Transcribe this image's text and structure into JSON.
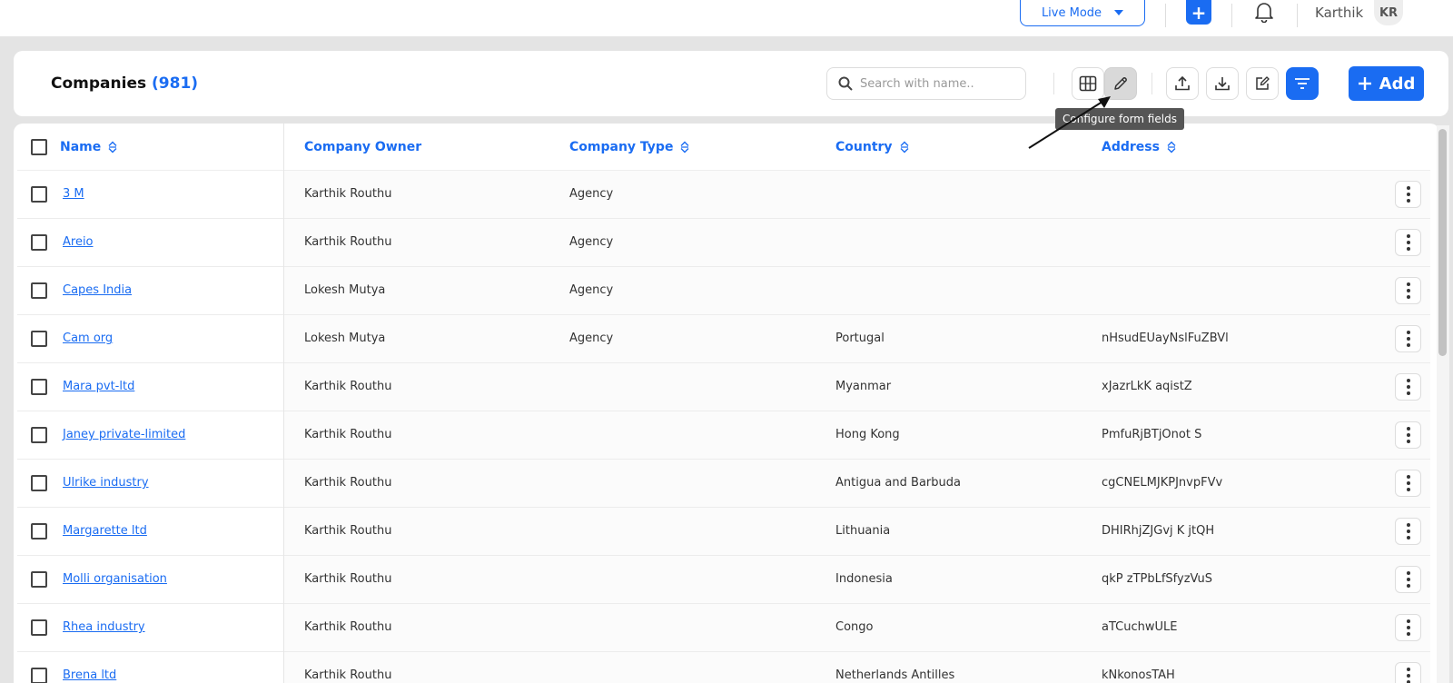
{
  "topbar": {
    "live_mode_label": "Live Mode",
    "plus_label": "+",
    "user_name": "Karthik",
    "avatar_initials": "KR"
  },
  "header": {
    "title": "Companies",
    "count": "(981)",
    "search_placeholder": "Search with name..",
    "add_label": "Add",
    "tooltip": "Configure form fields"
  },
  "icons": {
    "columns": "columns-icon",
    "edit": "pencil-icon",
    "upload": "upload-icon",
    "download": "download-icon",
    "edit_box": "edit-box-icon",
    "filter": "filter-icon"
  },
  "colors": {
    "accent": "#1a6cf2"
  },
  "table": {
    "columns": [
      "Name",
      "Company Owner",
      "Company Type",
      "Country",
      "Address"
    ],
    "rows": [
      {
        "name": "3 M",
        "owner": "Karthik Routhu",
        "type": "Agency",
        "country": "",
        "address": ""
      },
      {
        "name": "Areio",
        "owner": "Karthik Routhu",
        "type": "Agency",
        "country": "",
        "address": ""
      },
      {
        "name": "Capes India",
        "owner": "Lokesh Mutya",
        "type": "Agency",
        "country": "",
        "address": ""
      },
      {
        "name": "Cam org",
        "owner": "Lokesh Mutya",
        "type": "Agency",
        "country": "Portugal",
        "address": "nHsudEUayNslFuZBVl"
      },
      {
        "name": "Mara pvt-ltd",
        "owner": "Karthik Routhu",
        "type": "",
        "country": "Myanmar",
        "address": "xJazrLkK aqistZ"
      },
      {
        "name": "Janey private-limited",
        "owner": "Karthik Routhu",
        "type": "",
        "country": "Hong Kong",
        "address": "PmfuRjBTjOnot S"
      },
      {
        "name": "Ulrike industry",
        "owner": "Karthik Routhu",
        "type": "",
        "country": "Antigua and Barbuda",
        "address": "cgCNELMJKPJnvpFVv"
      },
      {
        "name": "Margarette ltd",
        "owner": "Karthik Routhu",
        "type": "",
        "country": "Lithuania",
        "address": "DHIRhjZJGvj K jtQH"
      },
      {
        "name": "Molli organisation",
        "owner": "Karthik Routhu",
        "type": "",
        "country": "Indonesia",
        "address": "qkP zTPbLfSfyzVuS"
      },
      {
        "name": "Rhea industry",
        "owner": "Karthik Routhu",
        "type": "",
        "country": "Congo",
        "address": "aTCuchwULE"
      },
      {
        "name": "Brena ltd",
        "owner": "Karthik Routhu",
        "type": "",
        "country": "Netherlands Antilles",
        "address": "kNkonosTAH"
      }
    ]
  }
}
